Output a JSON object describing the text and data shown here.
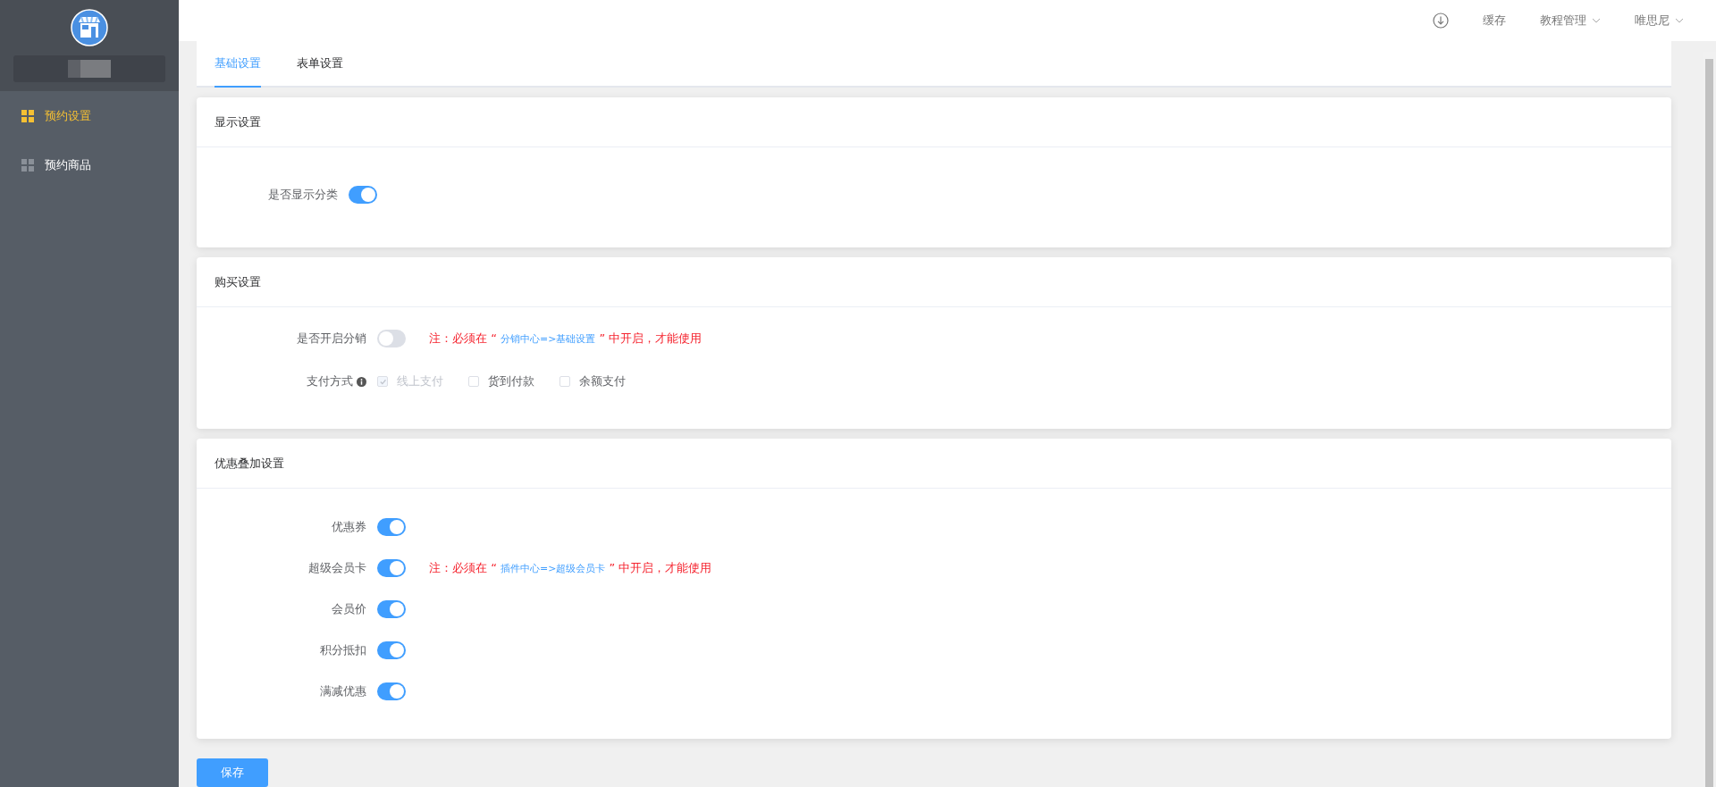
{
  "sidebar": {
    "items": [
      {
        "label": "预约设置",
        "selected": true
      },
      {
        "label": "预约商品",
        "selected": false
      }
    ]
  },
  "header": {
    "cache": "缓存",
    "menus": [
      {
        "label": "教程管理"
      },
      {
        "label": "唯思尼"
      }
    ]
  },
  "tabs": [
    {
      "label": "基础设置",
      "selected": true
    },
    {
      "label": "表单设置",
      "selected": false
    }
  ],
  "sections": [
    {
      "title": "显示设置",
      "fields": [
        {
          "kind": "switch",
          "label": "是否显示分类",
          "on": true
        }
      ]
    },
    {
      "title": "购买设置",
      "fields": [
        {
          "kind": "switch",
          "label": "是否开启分销",
          "on": false,
          "note": {
            "prefix": "注：必须在 “ ",
            "link": "分销中心=>基础设置",
            "suffix": " ” 中开启，才能使用"
          }
        },
        {
          "kind": "checkboxes",
          "label": "支付方式",
          "info": true,
          "options": [
            {
              "label": "线上支付",
              "checked": true,
              "disabled": true
            },
            {
              "label": "货到付款",
              "checked": false,
              "disabled": false
            },
            {
              "label": "余额支付",
              "checked": false,
              "disabled": false
            }
          ]
        }
      ]
    },
    {
      "title": "优惠叠加设置",
      "fields": [
        {
          "kind": "switch",
          "label": "优惠券",
          "on": true
        },
        {
          "kind": "switch",
          "label": "超级会员卡",
          "on": true,
          "note": {
            "prefix": "注：必须在 “ ",
            "link": "插件中心=>超级会员卡",
            "suffix": " ” 中开启，才能使用"
          }
        },
        {
          "kind": "switch",
          "label": "会员价",
          "on": true
        },
        {
          "kind": "switch",
          "label": "积分抵扣",
          "on": true
        },
        {
          "kind": "switch",
          "label": "满减优惠",
          "on": true
        }
      ]
    }
  ],
  "save_button": "保存"
}
